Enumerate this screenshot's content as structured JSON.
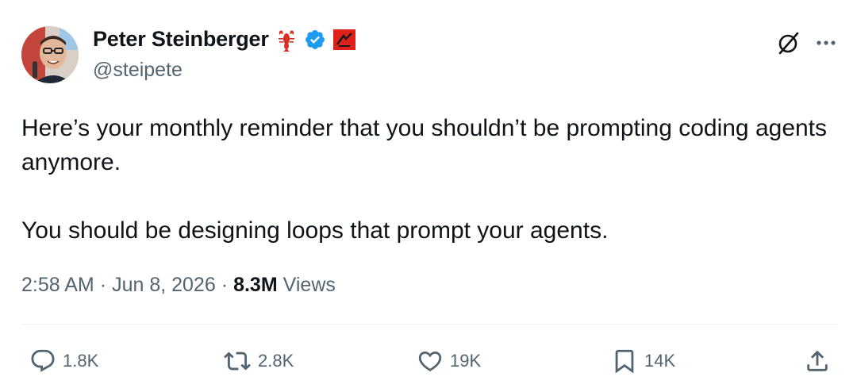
{
  "author": {
    "name": "Peter Steinberger",
    "handle": "@steipete",
    "emoji_icons": [
      "lobster-icon",
      "verified-badge-icon",
      "flag-badge-icon"
    ]
  },
  "header_actions": {
    "grok_icon": "slash-circle-icon",
    "more_icon": "more-dots-icon"
  },
  "tweet": {
    "paragraphs": [
      "Here’s your monthly reminder that you shouldn’t be prompting coding agents anymore.",
      "You should be designing loops that prompt your agents."
    ],
    "time": "2:58 AM",
    "separator": "·",
    "date": "Jun 8, 2026",
    "views_count": "8.3M",
    "views_label": "Views"
  },
  "actions": {
    "replies": "1.8K",
    "reposts": "2.8K",
    "likes": "19K",
    "bookmarks": "14K"
  },
  "colors": {
    "text_primary": "#0f1419",
    "text_secondary": "#536471",
    "verified": "#1d9bf0",
    "divider": "#eff3f4"
  }
}
